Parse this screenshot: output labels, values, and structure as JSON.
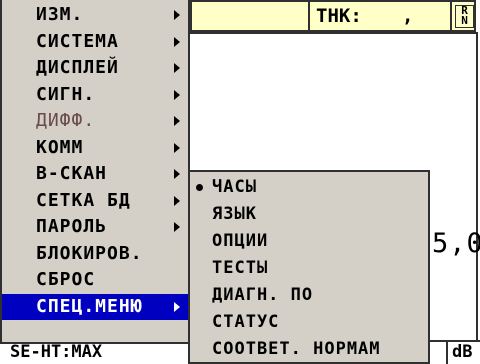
{
  "status_bar": {
    "thk_label": "THK:",
    "thk_value": ",",
    "r_badge_top": "R",
    "r_badge_bottom": "N"
  },
  "reading": "5,0",
  "bottom_bar": {
    "left_text": "SE-HT:MAX",
    "unit": "dB"
  },
  "main_menu": {
    "items": [
      {
        "label": "ИЗМ.",
        "has_submenu": true,
        "state": "normal"
      },
      {
        "label": "СИСТЕМА",
        "has_submenu": true,
        "state": "normal"
      },
      {
        "label": "ДИСПЛЕЙ",
        "has_submenu": true,
        "state": "normal"
      },
      {
        "label": "СИГН.",
        "has_submenu": true,
        "state": "normal"
      },
      {
        "label": "ДИФФ.",
        "has_submenu": true,
        "state": "disabled"
      },
      {
        "label": "КОММ",
        "has_submenu": true,
        "state": "normal"
      },
      {
        "label": "В-СКАН",
        "has_submenu": true,
        "state": "normal"
      },
      {
        "label": "СЕТКА БД",
        "has_submenu": true,
        "state": "normal"
      },
      {
        "label": "ПАРОЛЬ",
        "has_submenu": true,
        "state": "normal"
      },
      {
        "label": "БЛОКИРОВ.",
        "has_submenu": false,
        "state": "normal"
      },
      {
        "label": "СБРОС",
        "has_submenu": false,
        "state": "normal"
      },
      {
        "label": "СПЕЦ.МЕНЮ",
        "has_submenu": true,
        "state": "selected"
      }
    ]
  },
  "submenu": {
    "items": [
      {
        "label": "ЧАСЫ",
        "checked": true
      },
      {
        "label": "ЯЗЫК",
        "checked": false
      },
      {
        "label": "ОПЦИИ",
        "checked": false
      },
      {
        "label": "ТЕСТЫ",
        "checked": false
      },
      {
        "label": "ДИАГН. ПО",
        "checked": false
      },
      {
        "label": "СТАТУС",
        "checked": false
      },
      {
        "label": "СООТВЕТ. НОРМАМ",
        "checked": false
      }
    ]
  },
  "colors": {
    "menu_bg": "#d4d0c8",
    "selected_bg": "#0000c0",
    "status_bg": "#ffffc8",
    "disabled_text": "#6b4a4a"
  }
}
